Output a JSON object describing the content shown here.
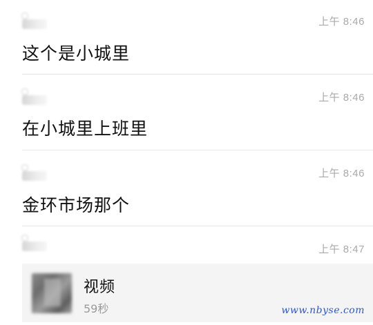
{
  "messages": [
    {
      "time": "上午 8:46",
      "text": "这个是小城里"
    },
    {
      "time": "上午 8:46",
      "text": "在小城里上班里"
    },
    {
      "time": "上午 8:46",
      "text": "金环市场那个"
    },
    {
      "time": "上午 8:47",
      "text": ""
    }
  ],
  "video": {
    "title": "视频",
    "duration": "59秒"
  },
  "watermark": "www.nbyse.com"
}
